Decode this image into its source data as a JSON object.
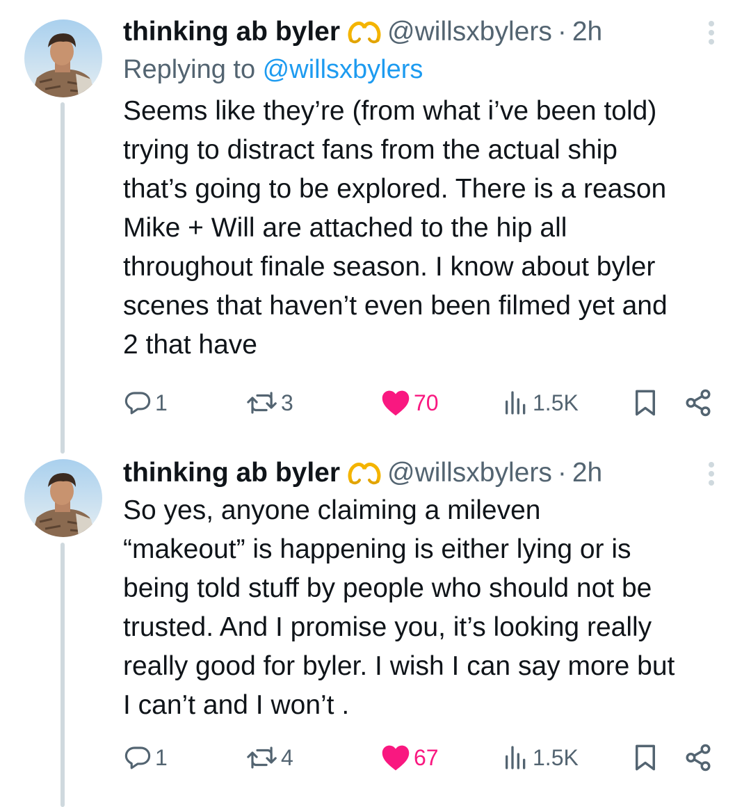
{
  "tweets": [
    {
      "author_name": "thinking ab byler",
      "author_badge_icon": "heart-hands-icon",
      "handle": "@willsxbylers",
      "separator": "·",
      "time": "2h",
      "replying_prefix": "Replying to ",
      "replying_handle": "@willsxbylers",
      "text": "Seems like they’re (from what i’ve been told)\ntrying to distract fans from the actual ship\nthat’s going to be explored. There is a reason\nMike + Will are attached to the hip all\nthroughout finale season. I know about byler\nscenes that haven’t even been filmed yet and\n2 that have",
      "replies": "1",
      "retweets": "3",
      "likes": "70",
      "views": "1.5K"
    },
    {
      "author_name": "thinking ab byler",
      "author_badge_icon": "heart-hands-icon",
      "handle": "@willsxbylers",
      "separator": "·",
      "time": "2h",
      "text": "So yes, anyone claiming a mileven\n“makeout” is happening is either lying or is\nbeing told stuff by people who should not be\ntrusted. And I promise you, it’s looking really\nreally good for byler. I wish I can say more but\nI can’t and I won’t .",
      "replies": "1",
      "retweets": "4",
      "likes": "67",
      "views": "1.5K"
    }
  ],
  "colors": {
    "text": "#0f1419",
    "secondary": "#536471",
    "link": "#1d9bf0",
    "like": "#f91880",
    "thread_line": "#cfd9de"
  }
}
